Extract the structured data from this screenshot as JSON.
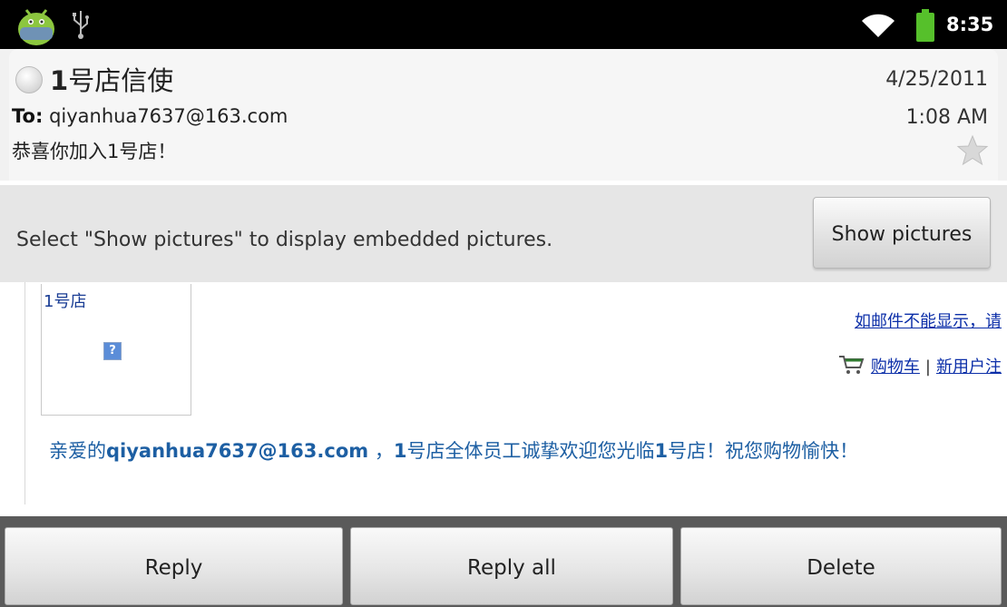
{
  "status_bar": {
    "time": "8:35",
    "icons": [
      "android-notification-icon",
      "usb-icon",
      "wifi-icon",
      "battery-icon"
    ]
  },
  "header": {
    "sender_prefix": "1",
    "sender_name": "号店信使",
    "date": "4/25/2011",
    "time": "1:08 AM",
    "to_label": "To:",
    "to_address": "qiyanhua7637@163.com",
    "subject": "恭喜你加入1号店！"
  },
  "pictures_notice": {
    "text": "Select \"Show pictures\" to display embedded pictures.",
    "button_label": "Show pictures"
  },
  "email_body": {
    "logo_alt": "1号店",
    "top_link": "如邮件不能显示，请",
    "cart_link": "购物车",
    "separator": "|",
    "register_link": "新用户注",
    "welcome": {
      "prefix": "亲爱的",
      "email": "qiyanhua7637@163.com",
      "middle": " ，",
      "brand1": "1",
      "text1": "号店全体员工诚挚欢迎您光临",
      "brand2": "1",
      "text2": "号店！祝您购物愉快！"
    }
  },
  "actions": {
    "reply": "Reply",
    "reply_all": "Reply all",
    "delete": "Delete"
  },
  "colors": {
    "status_bar": "#000000",
    "link": "#0b2ea8",
    "welcome_text": "#1d5fa3",
    "battery": "#56c02b"
  }
}
